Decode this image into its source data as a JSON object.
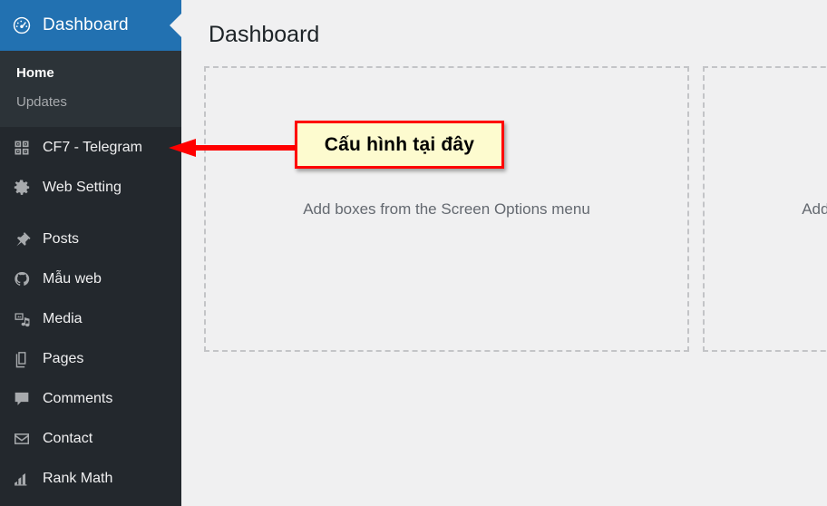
{
  "sidebar": {
    "current_menu": {
      "label": "Dashboard",
      "icon": "dashboard-gauge-icon",
      "background_color": "#2271b1"
    },
    "submenu": [
      {
        "label": "Home",
        "state": "current"
      },
      {
        "label": "Updates",
        "state": "default"
      }
    ],
    "items": [
      {
        "label": "CF7 - Telegram",
        "icon": "qr-code-icon"
      },
      {
        "label": "Web Setting",
        "icon": "gear-icon"
      },
      {
        "label": "Posts",
        "icon": "pin-icon"
      },
      {
        "label": "Mẫu web",
        "icon": "appearance-brush-icon"
      },
      {
        "label": "Media",
        "icon": "media-icon"
      },
      {
        "label": "Pages",
        "icon": "pages-icon"
      },
      {
        "label": "Comments",
        "icon": "comment-bubble-icon"
      },
      {
        "label": "Contact",
        "icon": "envelope-icon"
      },
      {
        "label": "Rank Math",
        "icon": "bar-chart-icon"
      }
    ],
    "background_color": "#23282d",
    "submenu_background_color": "#2c3338"
  },
  "main": {
    "page_title": "Dashboard",
    "placeholders": [
      {
        "text": "Add boxes from the Screen Options menu"
      },
      {
        "text": "Add boxes from the Screen Options menu"
      }
    ]
  },
  "annotation": {
    "text": "Cấu hình tại đây",
    "box_fill_color": "#fdfbcf",
    "box_border_color": "#ff0000",
    "arrow_color": "#ff0000",
    "arrow_direction": "left",
    "points_to": "CF7 - Telegram"
  }
}
